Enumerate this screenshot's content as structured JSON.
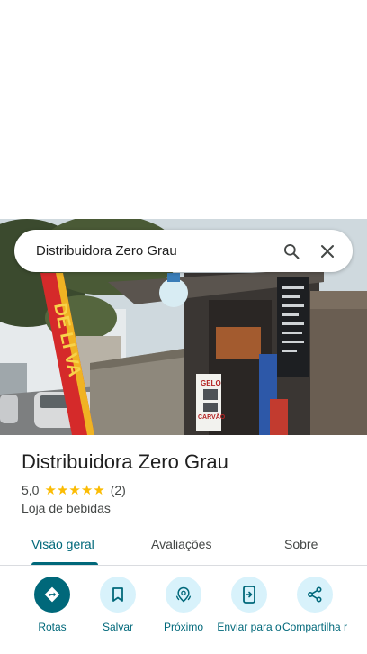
{
  "search": {
    "query": "Distribuidora Zero Grau"
  },
  "place": {
    "name": "Distribuidora Zero Grau",
    "rating": "5,0",
    "review_count": "(2)",
    "category": "Loja de bebidas",
    "photo_signs": {
      "banner": "DE LI VA",
      "store_sign_1": "GELO",
      "store_sign_2": "CARVÃO"
    }
  },
  "tabs": [
    {
      "label": "Visão geral",
      "active": true
    },
    {
      "label": "Avaliações",
      "active": false
    },
    {
      "label": "Sobre",
      "active": false
    }
  ],
  "actions": [
    {
      "label": "Rotas",
      "icon": "directions-icon"
    },
    {
      "label": "Salvar",
      "icon": "bookmark-icon"
    },
    {
      "label": "Próximo",
      "icon": "nearby-icon"
    },
    {
      "label": "Enviar para o",
      "icon": "send-to-phone-icon"
    },
    {
      "label": "Compartilha r",
      "icon": "share-icon"
    }
  ],
  "colors": {
    "accent": "#00687a",
    "star": "#fbbc04",
    "action_bg": "#d8f2fb"
  }
}
